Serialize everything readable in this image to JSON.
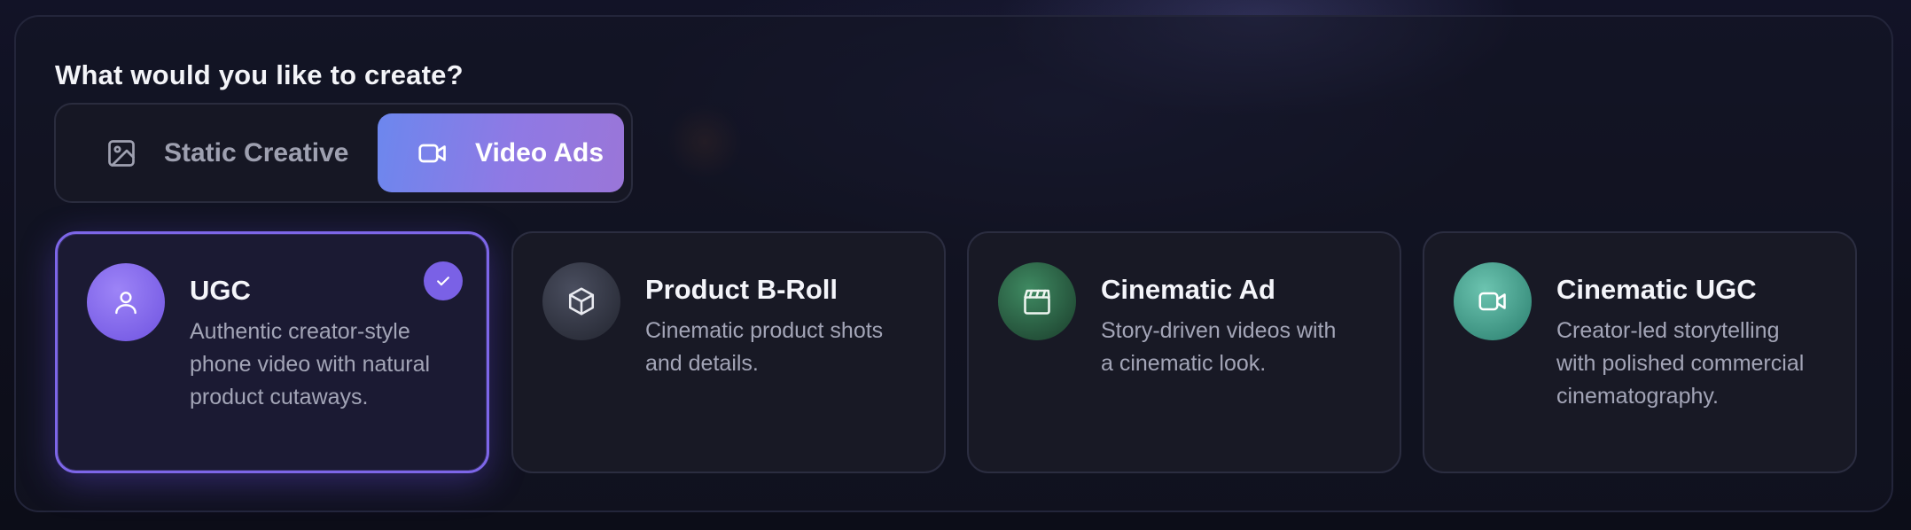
{
  "heading": "What would you like to create?",
  "mode_toggle": {
    "options": [
      {
        "label": "Static Creative",
        "icon": "image-icon",
        "selected": false
      },
      {
        "label": "Video Ads",
        "icon": "video-camera-icon",
        "selected": true
      }
    ]
  },
  "video_types": [
    {
      "title": "UGC",
      "description": "Authentic creator-style phone video with natural product cutaways.",
      "icon": "user-icon",
      "icon_color": "#8b6cf0",
      "selected": true
    },
    {
      "title": "Product B-Roll",
      "description": "Cinematic product shots and details.",
      "icon": "cube-icon",
      "icon_color": "#3a3d4c",
      "selected": false
    },
    {
      "title": "Cinematic Ad",
      "description": "Story-driven videos with a cinematic look.",
      "icon": "clapperboard-icon",
      "icon_color": "#2f6a4a",
      "selected": false
    },
    {
      "title": "Cinematic UGC",
      "description": "Creator-led storytelling with polished commercial cinematography.",
      "icon": "video-camera-icon",
      "icon_color": "#4aa291",
      "selected": false
    }
  ],
  "colors": {
    "accent": "#7d66e8",
    "toggle_gradient_start": "#6c87ee",
    "toggle_gradient_end": "#9a76d8",
    "background": "#0d0e1a"
  }
}
